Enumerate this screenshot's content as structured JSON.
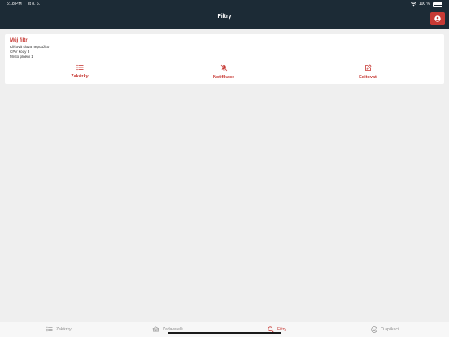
{
  "statusbar": {
    "time": "5:18 PM",
    "date": "st 8. 6.",
    "battery": "100 %",
    "wifi_icon": "wifi-icon",
    "battery_icon": "battery-icon"
  },
  "header": {
    "title": "Filtry",
    "profile_icon": "user-icon"
  },
  "filter_card": {
    "name": "Můj filtr",
    "keywords": "Klíčová slova nepoužito",
    "cpv": "CPV kódy 3",
    "place": "Místo plnění 1",
    "actions": [
      {
        "label": "Zakázky",
        "icon": "list-icon"
      },
      {
        "label": "Notifikace",
        "icon": "bell-off-icon"
      },
      {
        "label": "Editovat",
        "icon": "edit-icon"
      }
    ]
  },
  "tabbar": {
    "active_color": "#c73a35",
    "tabs": [
      {
        "label": "Zakázky",
        "icon": "list-icon"
      },
      {
        "label": "Zadavatelé",
        "icon": "building-icon"
      },
      {
        "label": "Filtry",
        "icon": "search-icon"
      },
      {
        "label": "O aplikaci",
        "icon": "smile-icon"
      }
    ]
  },
  "colors": {
    "header_bg": "#1c2b36",
    "accent": "#c73a35",
    "page_bg": "#efefef"
  }
}
